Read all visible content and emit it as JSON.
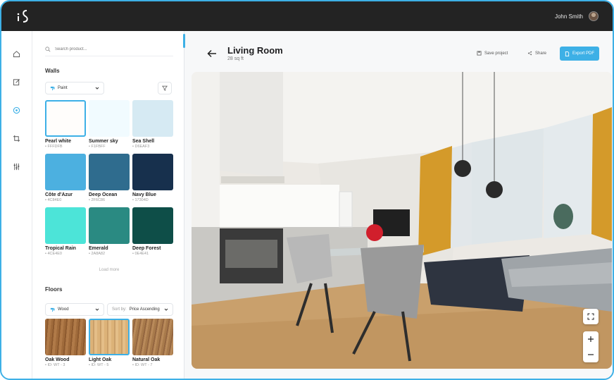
{
  "app": {
    "logo_text": "iS"
  },
  "user": {
    "name": "John Smith"
  },
  "rail": {
    "items": [
      "home-icon",
      "edit-icon",
      "layers-icon",
      "crop-icon",
      "sliders-icon"
    ]
  },
  "search": {
    "placeholder": "Search product..."
  },
  "walls": {
    "title": "Walls",
    "type_label": "Paint",
    "swatches": [
      {
        "name": "Pearl white",
        "code": "FFFDFB",
        "color": "#FFFDFB",
        "selected": true
      },
      {
        "name": "Summer sky",
        "code": "F1FBFF",
        "color": "#F1FBFF"
      },
      {
        "name": "Sea Shell",
        "code": "D6EAF3",
        "color": "#D6EAF3"
      },
      {
        "name": "Côte d'Azur",
        "code": "4C84E0",
        "color": "#4CB0E0"
      },
      {
        "name": "Deep Ocean",
        "code": "2F6C86",
        "color": "#2F6C8E"
      },
      {
        "name": "Navy Blue",
        "code": "17304D",
        "color": "#17304D"
      },
      {
        "name": "Tropical Rain",
        "code": "4CE4E0",
        "color": "#4CE4D8"
      },
      {
        "name": "Emerald",
        "code": "2A8A82",
        "color": "#2A8A82"
      },
      {
        "name": "Deep Forest",
        "code": "0E4E41",
        "color": "#0E4E48"
      }
    ],
    "load_more": "Load more"
  },
  "floors": {
    "title": "Floors",
    "type_label": "Wood",
    "sort_prefix": "Sort by:",
    "sort_value": "Price Ascending",
    "tiles": [
      {
        "name": "Oak Wood",
        "code": "ID: WT - 3",
        "color": "#a06b3b"
      },
      {
        "name": "Light Oak",
        "code": "ID: WT - 5",
        "color": "#dcb278",
        "selected": true
      },
      {
        "name": "Natural Oak",
        "code": "ID: WT - 7",
        "color": "#a87a4b"
      }
    ]
  },
  "main": {
    "room_title": "Living Room",
    "room_size": "28 sq ft",
    "save_label": "Save project",
    "share_label": "Share",
    "export_label": "Export PDF"
  },
  "colors": {
    "accent": "#3db0e6",
    "topbar": "#232323"
  }
}
